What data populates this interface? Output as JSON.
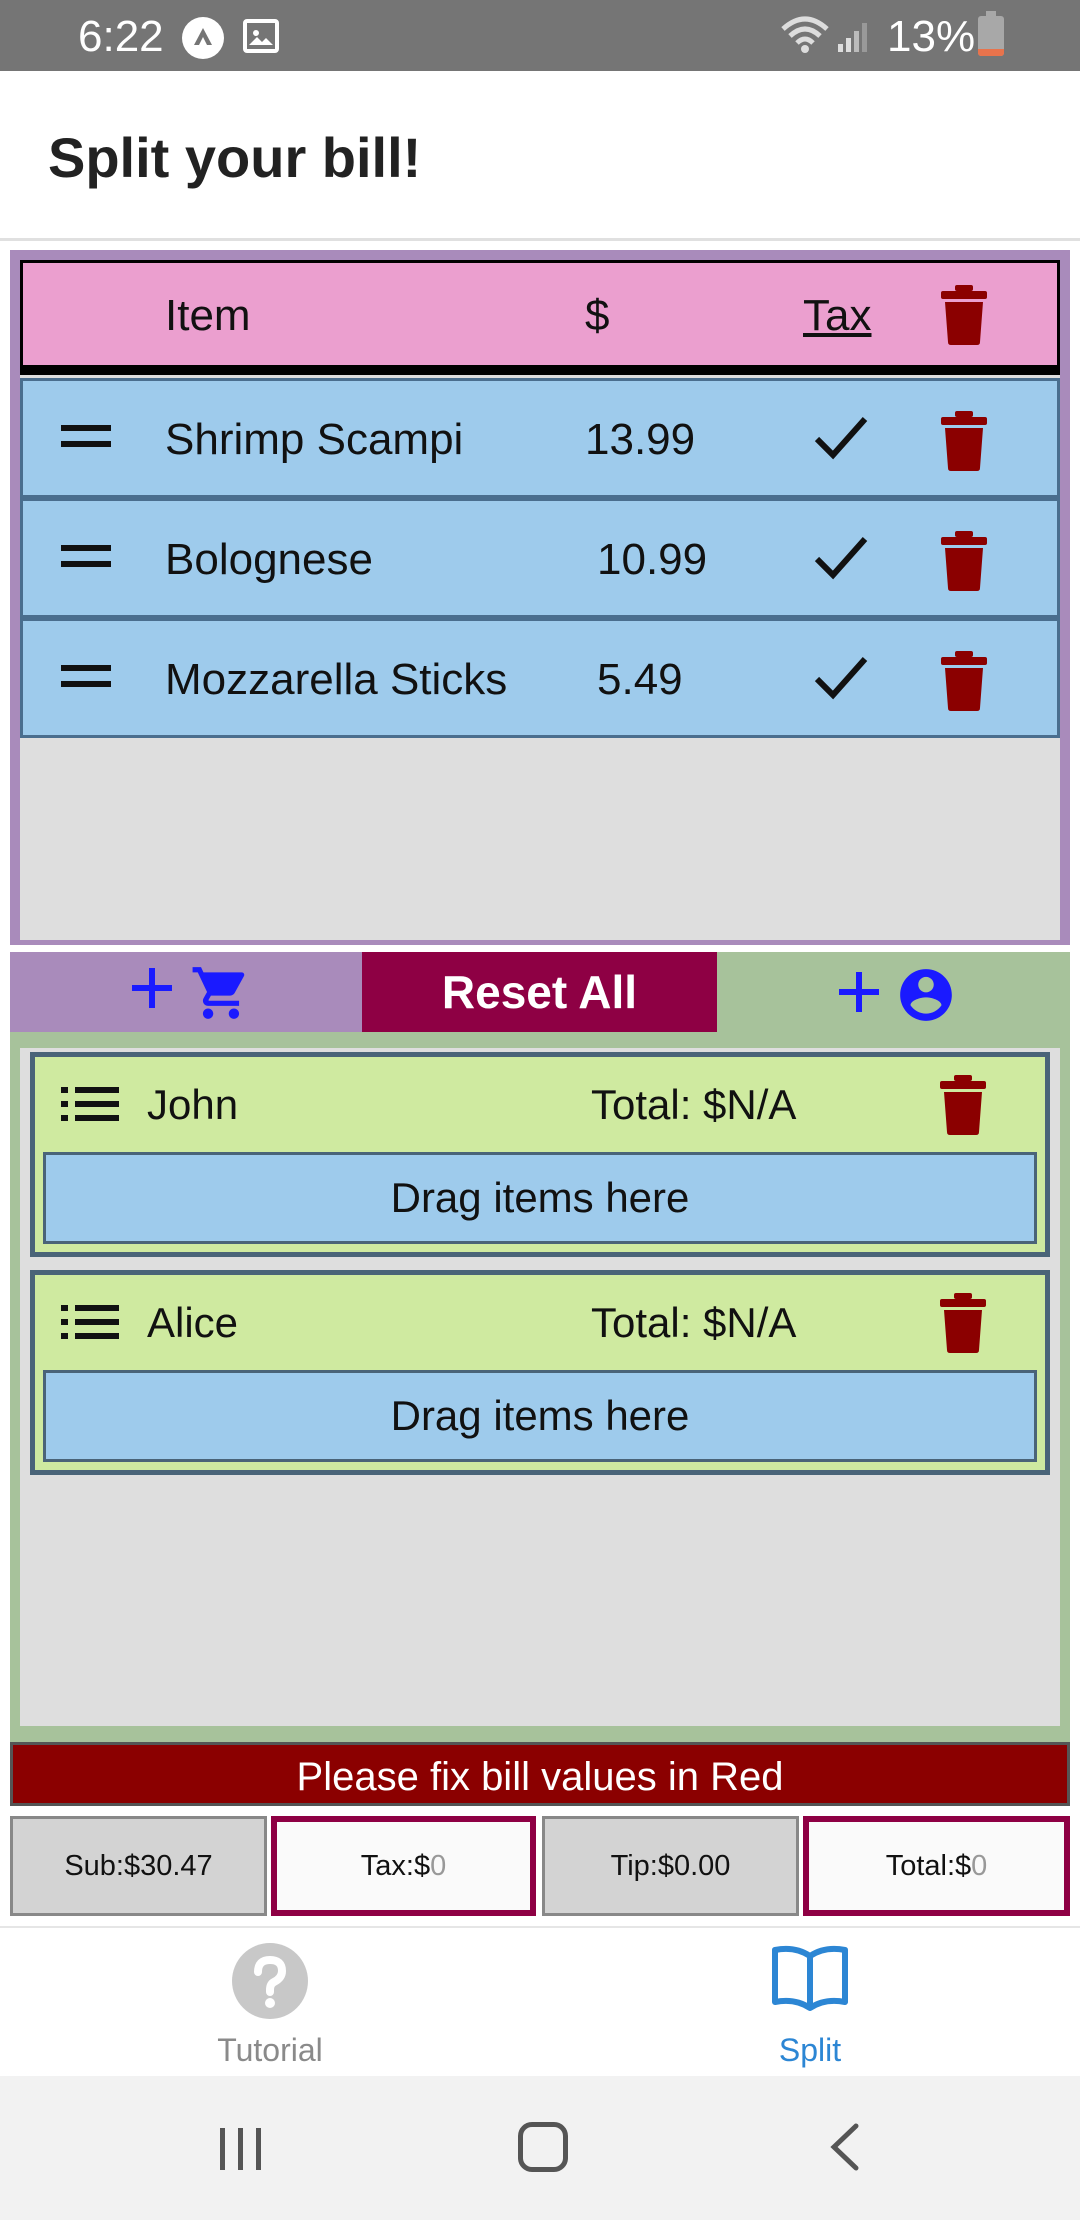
{
  "status_bar": {
    "time": "6:22",
    "battery_percent": "13%",
    "icons": [
      "app-notification-icon",
      "image-icon",
      "wifi-icon",
      "signal-icon",
      "battery-icon"
    ]
  },
  "header": {
    "title": "Split your bill!"
  },
  "items_table": {
    "headers": {
      "item": "Item",
      "price": "$",
      "tax": "Tax"
    },
    "rows": [
      {
        "name": "Shrimp Scampi",
        "price": "13.99",
        "taxed": true
      },
      {
        "name": "Bolognese",
        "price": "10.99",
        "taxed": true
      },
      {
        "name": "Mozzarella Sticks",
        "price": "5.49",
        "taxed": true
      }
    ]
  },
  "actions": {
    "reset_label": "Reset All"
  },
  "people": [
    {
      "name": "John",
      "total": "Total: $N/A",
      "drop_hint": "Drag items here"
    },
    {
      "name": "Alice",
      "total": "Total: $N/A",
      "drop_hint": "Drag items here"
    }
  ],
  "error_message": "Please fix bill values in Red",
  "totals": {
    "sub": "Sub:$30.47",
    "tax_label": "Tax:$",
    "tax_placeholder": "0",
    "tip": "Tip:$0.00",
    "total_label": "Total:$",
    "total_placeholder": "0"
  },
  "tabs": [
    {
      "label": "Tutorial",
      "icon": "help-icon",
      "active": false
    },
    {
      "label": "Split",
      "icon": "book-open-icon",
      "active": true
    }
  ],
  "colors": {
    "accent": "#1a73c8",
    "danger": "#8b0000",
    "reset": "#8e0044",
    "item_bg": "#9ecbec",
    "person_bg": "#cfeaa0",
    "header_pink": "#eb9fcf"
  }
}
